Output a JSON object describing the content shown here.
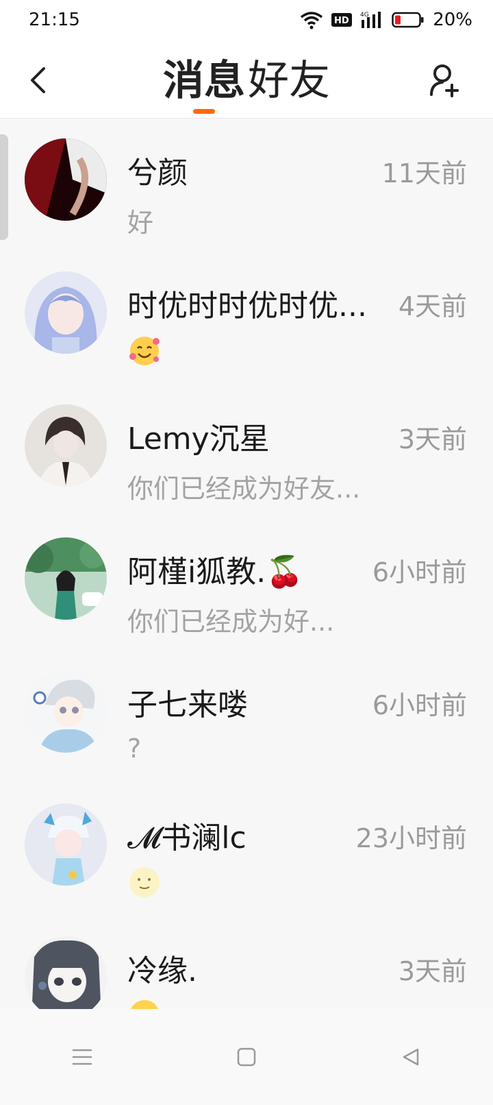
{
  "status_bar": {
    "time": "21:15",
    "battery": "20%",
    "icons": [
      "wifi-icon",
      "hd-icon",
      "signal-4g-icon",
      "battery-icon"
    ]
  },
  "header": {
    "tabs": [
      {
        "label": "消息",
        "active": true
      },
      {
        "label": "好友",
        "active": false
      }
    ],
    "icons": [
      "back-icon",
      "add-friend-icon"
    ],
    "accent": "#ff6a00"
  },
  "conversations": [
    {
      "name": "兮颜",
      "time": "11天前",
      "preview": "好"
    },
    {
      "name": "时优时时优时优...",
      "time": "4天前",
      "preview_icon": "smiling-face-with-hearts-emoji"
    },
    {
      "name": "Lemy沉星",
      "time": "3天前",
      "preview": "你们已经成为好友..."
    },
    {
      "name": "阿槿i狐教.🍒",
      "time": "6小时前",
      "preview": "你们已经成为好..."
    },
    {
      "name": "子七来喽",
      "time": "6小时前",
      "preview": "?"
    },
    {
      "name": "𝓜书澜lc",
      "time": "23小时前",
      "preview_icon": "full-moon-face-emoji"
    },
    {
      "name": "冷缘.",
      "time": "3天前",
      "preview_icon": "emoji"
    }
  ],
  "nav_bar": {
    "icons": [
      "menu-icon",
      "home-icon",
      "back-triangle-icon"
    ]
  }
}
